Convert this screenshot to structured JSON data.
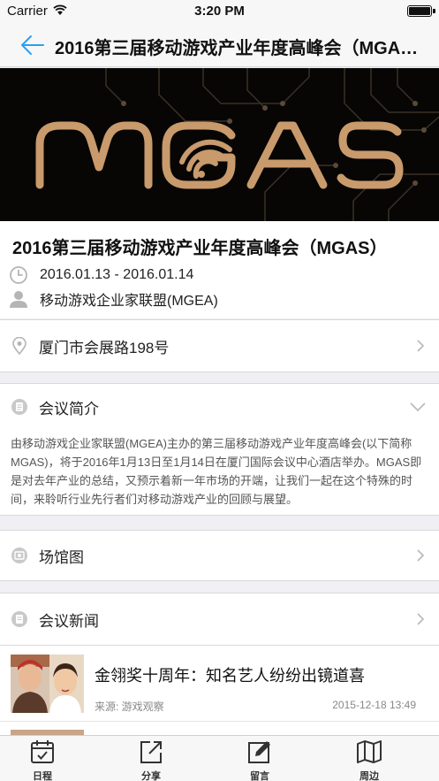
{
  "status_bar": {
    "carrier": "Carrier",
    "time": "3:20 PM",
    "battery_level": 1.0
  },
  "nav": {
    "back_icon": "back-arrow-icon",
    "title": "2016第三届移动游戏产业年度高峰会（MGAS）"
  },
  "banner": {
    "logo_text": "MGAS"
  },
  "event": {
    "title": "2016第三届移动游戏产业年度高峰会（MGAS）",
    "dates": "2016.01.13 - 2016.01.14",
    "organizer": "移动游戏企业家联盟(MGEA)"
  },
  "location": {
    "address": "厦门市会展路198号"
  },
  "intro": {
    "heading": "会议简介",
    "text": "由移动游戏企业家联盟(MGEA)主办的第三届移动游戏产业年度高峰会(以下简称MGAS)，将于2016年1月13日至1月14日在厦门国际会议中心酒店举办。MGAS即是对去年产业的总结，又预示着新一年市场的开端，让我们一起在这个特殊的时间，来聆听行业先行者们对移动游戏产业的回顾与展望。"
  },
  "venue": {
    "heading": "场馆图"
  },
  "news": {
    "heading": "会议新闻",
    "items": [
      {
        "title": "金翎奖十周年：知名艺人纷纷出镜道喜",
        "source": "来源: 游戏观察",
        "date": "2015-12-18 13:49"
      }
    ]
  },
  "tabs": [
    {
      "label": "日程",
      "icon": "calendar-icon"
    },
    {
      "label": "分享",
      "icon": "share-icon"
    },
    {
      "label": "留言",
      "icon": "compose-icon"
    },
    {
      "label": "周边",
      "icon": "map-icon"
    }
  ],
  "colors": {
    "accent": "#2b9ff0",
    "banner_bg": "#070605",
    "logo_gold": "#c89a6c"
  }
}
